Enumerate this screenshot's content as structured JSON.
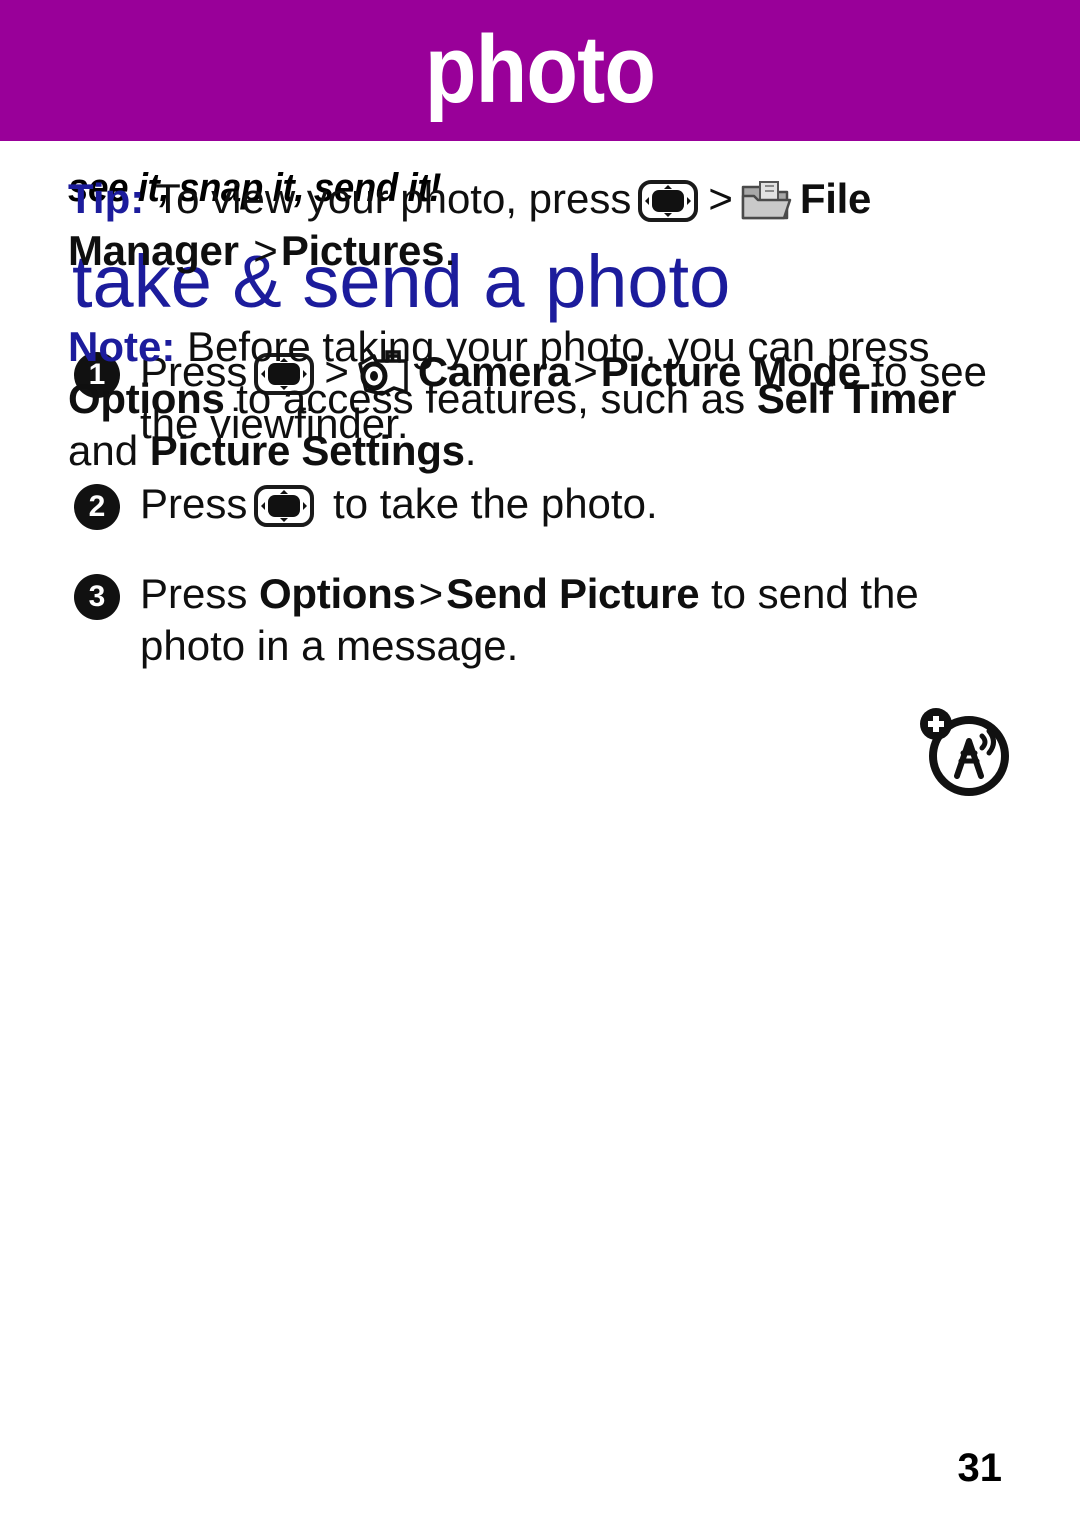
{
  "header": {
    "title": "photo",
    "band_color": "#990099",
    "title_color": "#ffffff"
  },
  "subtitle": "see it, snap it, send it!",
  "section_heading": {
    "text": "take & send a photo",
    "color": "#1c1c9c"
  },
  "steps": [
    {
      "number": "1",
      "press_label": "Press",
      "icon_1": "dpad-key-icon",
      "separator_1": ">",
      "icon_2": "camera-icon",
      "term_1": "Camera",
      "separator_2": ">",
      "term_2": "Picture Mode",
      "tail": "to see the viewfinder."
    },
    {
      "number": "2",
      "press_label": "Press",
      "icon_1": "dpad-key-icon",
      "tail": "to take the photo."
    },
    {
      "number": "3",
      "press_label": "Press",
      "term_1": "Options",
      "separator_1": ">",
      "term_2": "Send Picture",
      "tail": "to send the photo in a message."
    }
  ],
  "tip": {
    "label": "Tip:",
    "label_color": "#1c1c9c",
    "text_before": "To view your photo, press",
    "icon_1": "dpad-key-icon",
    "separator_1": ">",
    "icon_2": "file-folder-icon",
    "term_1": "File Manager",
    "separator_2": ">",
    "term_2": "Pictures",
    "tail": "."
  },
  "note": {
    "label": "Note:",
    "label_color": "#1c1c9c",
    "text_before": "Before taking your photo, you can press",
    "term_1": "Options",
    "text_middle": "to access features, such as",
    "term_2": "Self Timer",
    "text_join": "and",
    "term_3": "Picture Settings",
    "tail": "."
  },
  "side_icon": {
    "name": "add-network-antenna-icon"
  },
  "footer": {
    "page_number": "31"
  }
}
